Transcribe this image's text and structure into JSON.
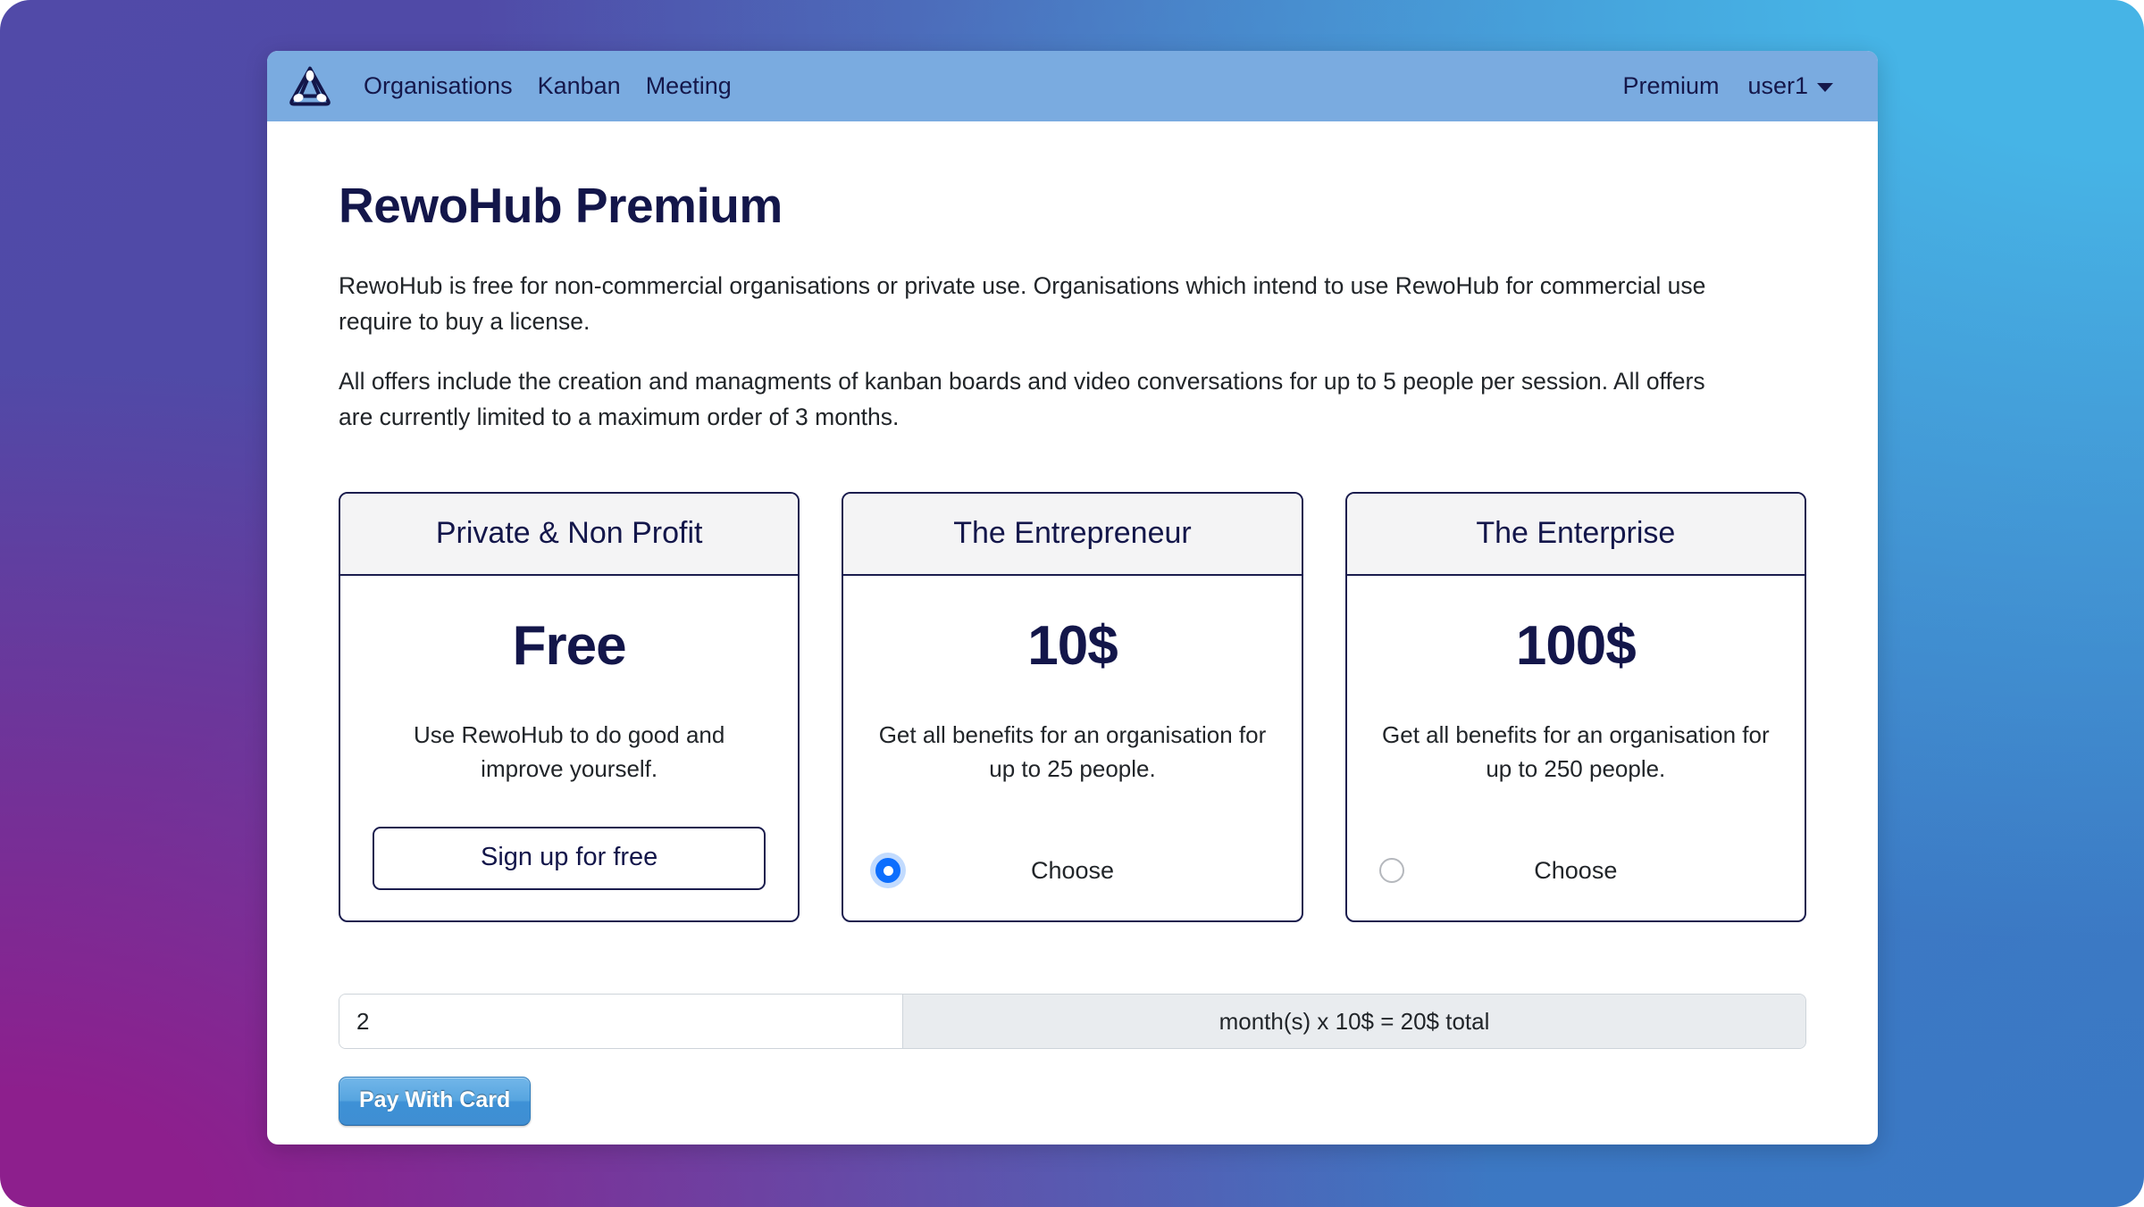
{
  "navbar": {
    "logo_icon": "rewohub-triangle-logo-icon",
    "links": [
      {
        "label": "Organisations"
      },
      {
        "label": "Kanban"
      },
      {
        "label": "Meeting"
      }
    ],
    "premium_label": "Premium",
    "user_label": "user1",
    "caret_icon": "chevron-down-icon",
    "background_color": "#7aabe0"
  },
  "main": {
    "title": "RewoHub Premium",
    "paragraph_1": "RewoHub is free for non-commercial organisations or private use. Organisations which intend to use RewoHub for commercial use require to buy a license.",
    "paragraph_2": "All offers include the creation and managments of kanban boards and video conversations for up to 5 people per session. All offers are currently limited to a maximum order of 3 months."
  },
  "plans": [
    {
      "title": "Private & Non Profit",
      "price": "Free",
      "description": "Use RewoHub to do good and improve yourself.",
      "action_type": "button",
      "action_label": "Sign up for free",
      "selected": false
    },
    {
      "title": "The Entrepreneur",
      "price": "10$",
      "description": "Get all benefits for an organisation for up to 25 people.",
      "action_type": "radio",
      "action_label": "Choose",
      "selected": true
    },
    {
      "title": "The Enterprise",
      "price": "100$",
      "description": "Get all benefits for an organisation for up to 250 people.",
      "action_type": "radio",
      "action_label": "Choose",
      "selected": false
    }
  ],
  "order": {
    "months_value": "2",
    "months_placeholder": "",
    "summary": "month(s) x 10$ = 20$ total",
    "pay_button_label": "Pay With Card"
  },
  "colors": {
    "navy": "#13164a",
    "radio_accent": "#0d6efd",
    "pay_button_blue": "#3f8ed2",
    "card_header_bg": "#f4f4f5"
  }
}
